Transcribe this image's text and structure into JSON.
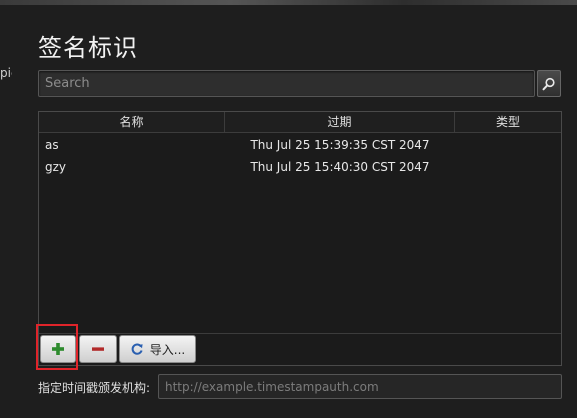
{
  "left_edge_text": "pic",
  "title": "签名标识",
  "search": {
    "placeholder": "Search",
    "icon": "search-icon"
  },
  "table": {
    "headers": [
      "名称",
      "过期",
      "类型"
    ],
    "rows": [
      {
        "name": "as",
        "expiry": "Thu Jul 25 15:39:35 CST 2047",
        "type": ""
      },
      {
        "name": "gzy",
        "expiry": "Thu Jul 25 15:40:30 CST 2047",
        "type": ""
      }
    ]
  },
  "toolbar": {
    "add_icon": "plus-icon",
    "remove_icon": "minus-icon",
    "import_icon": "refresh-icon",
    "import_label": "导入..."
  },
  "timestamp": {
    "label": "指定时间戳颁发机构:",
    "placeholder": "http://example.timestampauth.com"
  },
  "colors": {
    "add_green": "#2e8b2e",
    "remove_red": "#b22a2a",
    "highlight_red": "#e0242a",
    "import_blue": "#2a5fb0"
  }
}
